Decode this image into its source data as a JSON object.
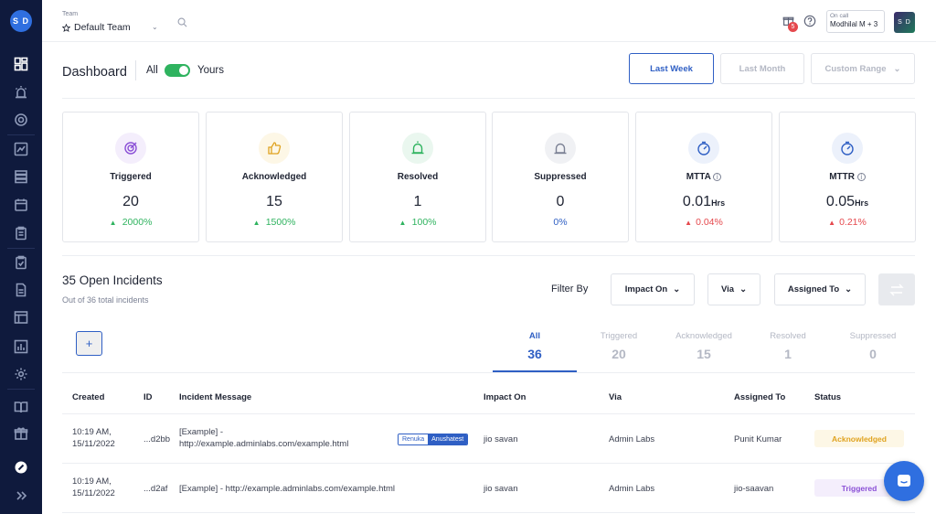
{
  "sidebar": {
    "avatar_initials": "S D",
    "items": [
      {
        "name": "dashboard-icon"
      },
      {
        "name": "alert-beacon-icon"
      },
      {
        "name": "target-icon"
      },
      {
        "name": "chart-icon"
      },
      {
        "name": "layers-icon"
      },
      {
        "name": "calendar-icon"
      },
      {
        "name": "clipboard-icon"
      },
      {
        "name": "clipboard-check-icon"
      },
      {
        "name": "document-icon"
      },
      {
        "name": "table-icon"
      },
      {
        "name": "bar-report-icon"
      },
      {
        "name": "gear-icon"
      },
      {
        "name": "book-icon"
      },
      {
        "name": "gift-icon"
      },
      {
        "name": "logo-icon"
      },
      {
        "name": "expand-icon"
      }
    ]
  },
  "topbar": {
    "team_label": "Team",
    "team_name": "Default Team",
    "gift_badge": "5",
    "oncall_label": "On call",
    "oncall_name": "Modhilal M + 3",
    "user_initials": "S D"
  },
  "dashboard": {
    "title": "Dashboard",
    "toggle_all": "All",
    "toggle_yours": "Yours",
    "ranges": {
      "week": "Last Week",
      "month": "Last Month",
      "custom": "Custom Range"
    }
  },
  "stats": [
    {
      "label": "Triggered",
      "value": "20",
      "unit": "",
      "delta": "2000%",
      "trend": "up",
      "info": false,
      "color": "#8a4fd6",
      "bg": "#f4eefc"
    },
    {
      "label": "Acknowledged",
      "value": "15",
      "unit": "",
      "delta": "1500%",
      "trend": "up",
      "info": false,
      "color": "#e0a320",
      "bg": "#fdf7e6"
    },
    {
      "label": "Resolved",
      "value": "1",
      "unit": "",
      "delta": "100%",
      "trend": "up",
      "info": false,
      "color": "#2fb35f",
      "bg": "#eaf7ef"
    },
    {
      "label": "Suppressed",
      "value": "0",
      "unit": "",
      "delta": "0%",
      "trend": "neutral",
      "info": false,
      "color": "#7b8194",
      "bg": "#f0f1f4"
    },
    {
      "label": "MTTA",
      "value": "0.01",
      "unit": "Hrs",
      "delta": "0.04%",
      "trend": "down",
      "info": true,
      "color": "#2f5fc4",
      "bg": "#ecf1fb"
    },
    {
      "label": "MTTR",
      "value": "0.05",
      "unit": "Hrs",
      "delta": "0.21%",
      "trend": "down",
      "info": true,
      "color": "#2f5fc4",
      "bg": "#ecf1fb"
    }
  ],
  "incidents": {
    "title": "35 Open Incidents",
    "subtitle": "Out of 36 total incidents",
    "filter_label": "Filter By",
    "filters": {
      "impact": "Impact On",
      "via": "Via",
      "assigned": "Assigned To"
    },
    "add_label": "+",
    "tabs": [
      {
        "label": "All",
        "count": "36"
      },
      {
        "label": "Triggered",
        "count": "20"
      },
      {
        "label": "Acknowledged",
        "count": "15"
      },
      {
        "label": "Resolved",
        "count": "1"
      },
      {
        "label": "Suppressed",
        "count": "0"
      }
    ],
    "columns": {
      "created": "Created",
      "id": "ID",
      "message": "Incident Message",
      "impact": "Impact On",
      "via": "Via",
      "assigned": "Assigned To",
      "status": "Status"
    },
    "rows": [
      {
        "created_time": "10:19 AM,",
        "created_date": "15/11/2022",
        "id": "...d2bb",
        "message_1": "[Example] -",
        "message_2": "http://example.adminlabs.com/example.html",
        "tag_1": "Renuka",
        "tag_2": "Anushatest",
        "impact": "jio savan",
        "via": "Admin Labs",
        "assigned": "Punit Kumar",
        "status": "Acknowledged"
      },
      {
        "created_time": "10:19 AM,",
        "created_date": "15/11/2022",
        "id": "...d2af",
        "message": "[Example] - http://example.adminlabs.com/example.html",
        "impact": "jio savan",
        "via": "Admin Labs",
        "assigned": "jio-saavan",
        "status": "Triggered"
      }
    ]
  }
}
